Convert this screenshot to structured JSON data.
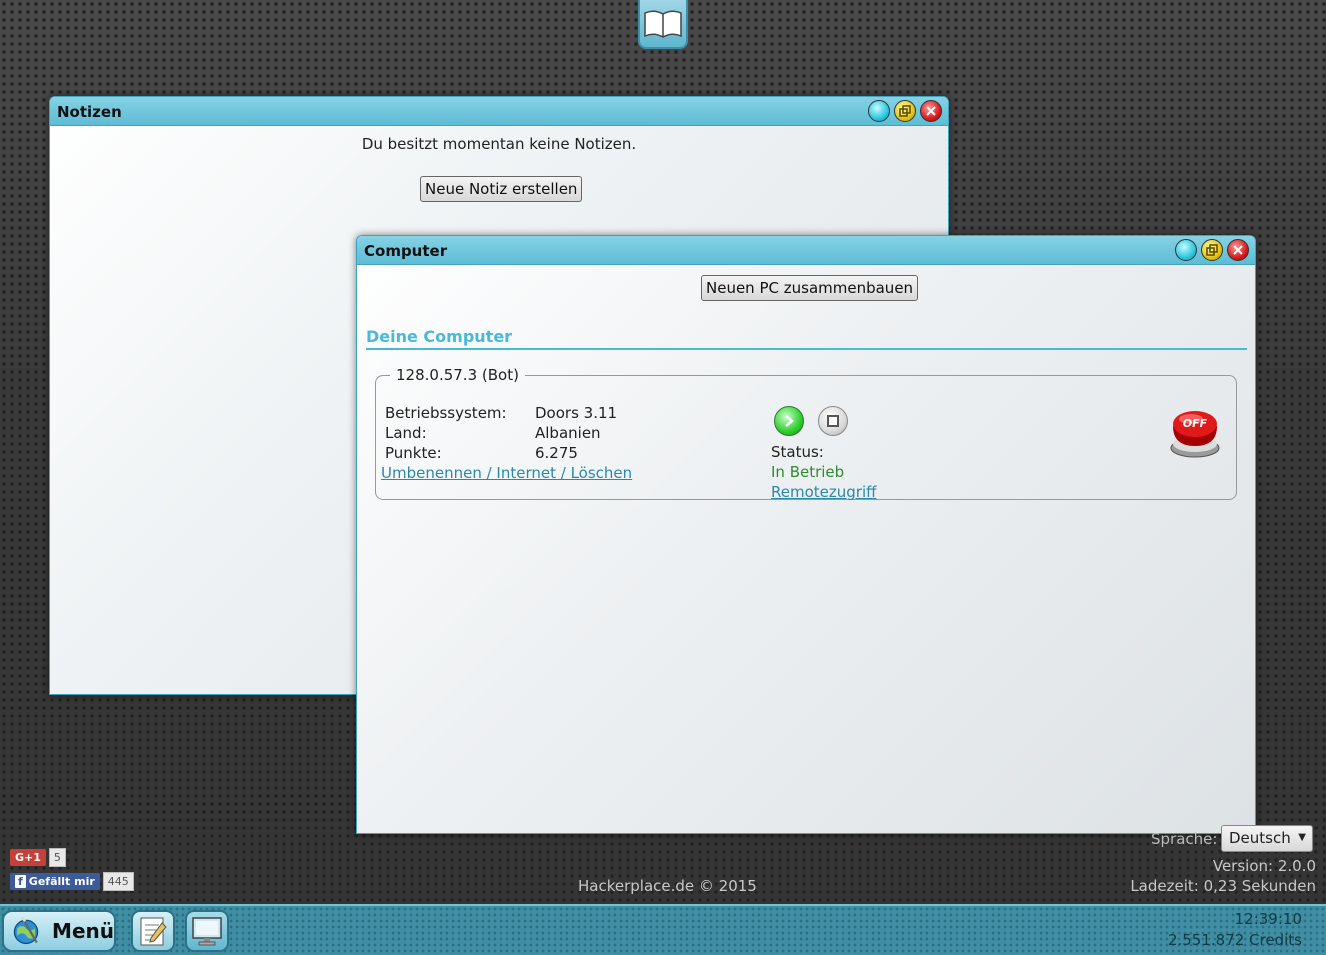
{
  "colors": {
    "accent": "#4ab9d8",
    "titlebar": "#5dbcd6",
    "status_ok": "#2f8c2f",
    "link": "#2a88a8"
  },
  "top_dock": {
    "icon": "book-icon"
  },
  "notes_window": {
    "title": "Notizen",
    "empty_message": "Du besitzt momentan keine Notizen.",
    "new_note_button": "Neue Notiz erstellen"
  },
  "computer_window": {
    "title": "Computer",
    "build_button": "Neuen PC zusammenbauen",
    "section_title": "Deine Computer",
    "pc": {
      "legend": "128.0.57.3 (Bot)",
      "os_label": "Betriebssystem:",
      "os_value": "Doors 3.11",
      "country_label": "Land:",
      "country_value": "Albanien",
      "points_label": "Punkte:",
      "points_value": "6.275",
      "actions_link": "Umbenennen / Internet / Löschen",
      "status_label": "Status:",
      "status_value": "In Betrieb",
      "remote_link": "Remotezugriff",
      "power_button_text": "OFF"
    }
  },
  "footer": {
    "gplus_label": "G+1",
    "gplus_count": "5",
    "fb_label": "Gefällt mir",
    "fb_count": "445",
    "copyright": "Hackerplace.de © 2015",
    "language_label": "Sprache:",
    "language_value": "Deutsch",
    "version": "Version: 2.0.0",
    "load_time": "Ladezeit: 0,23 Sekunden"
  },
  "taskbar": {
    "menu_label": "Menü",
    "time": "12:39:10",
    "credits": "2.551.872 Credits"
  }
}
